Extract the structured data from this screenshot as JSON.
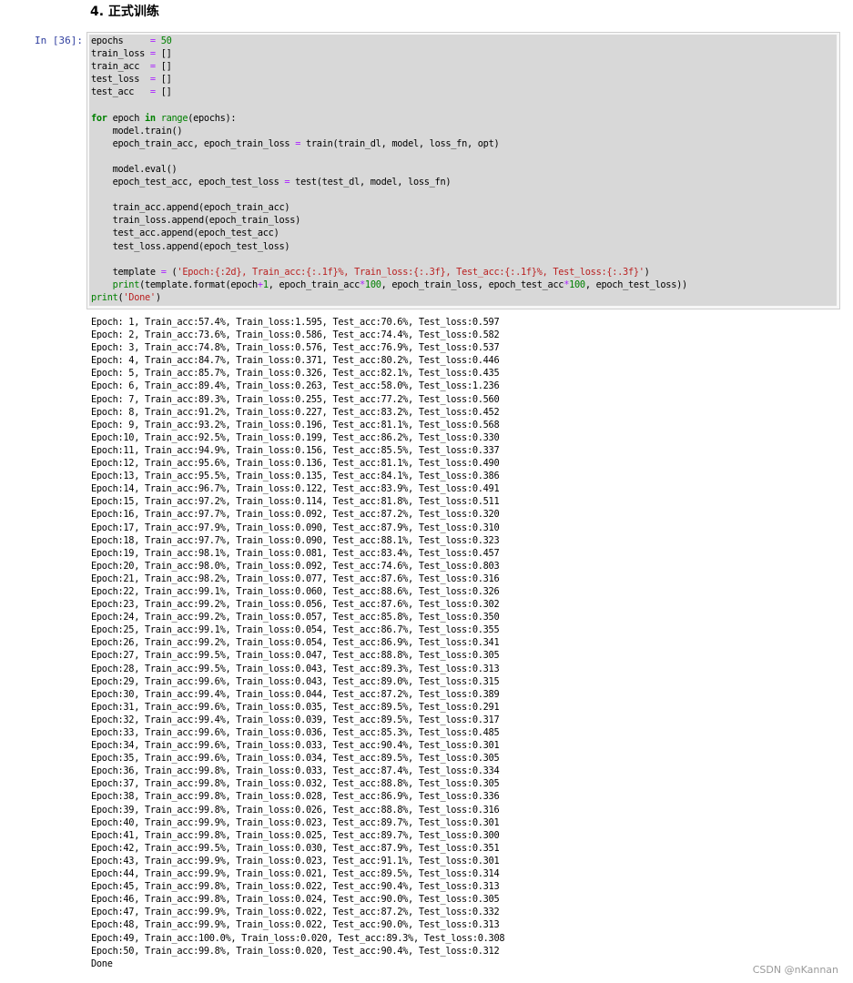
{
  "heading": "4. 正式训练",
  "cell": {
    "prompt": "In [36]:",
    "code_lines": [
      "epochs     = 50",
      "train_loss = []",
      "train_acc  = []",
      "test_loss  = []",
      "test_acc   = []",
      "",
      "for epoch in range(epochs):",
      "    model.train()",
      "    epoch_train_acc, epoch_train_loss = train(train_dl, model, loss_fn, opt)",
      "",
      "    model.eval()",
      "    epoch_test_acc, epoch_test_loss = test(test_dl, model, loss_fn)",
      "",
      "    train_acc.append(epoch_train_acc)",
      "    train_loss.append(epoch_train_loss)",
      "    test_acc.append(epoch_test_acc)",
      "    test_loss.append(epoch_test_loss)",
      "",
      "    template = ('Epoch:{:2d}, Train_acc:{:.1f}%, Train_loss:{:.3f}, Test_acc:{:.1f}%, Test_loss:{:.3f}')",
      "    print(template.format(epoch+1, epoch_train_acc*100, epoch_train_loss, epoch_test_acc*100, epoch_test_loss))",
      "print('Done')"
    ]
  },
  "output_lines": [
    "Epoch: 1, Train_acc:57.4%, Train_loss:1.595, Test_acc:70.6%, Test_loss:0.597",
    "Epoch: 2, Train_acc:73.6%, Train_loss:0.586, Test_acc:74.4%, Test_loss:0.582",
    "Epoch: 3, Train_acc:74.8%, Train_loss:0.576, Test_acc:76.9%, Test_loss:0.537",
    "Epoch: 4, Train_acc:84.7%, Train_loss:0.371, Test_acc:80.2%, Test_loss:0.446",
    "Epoch: 5, Train_acc:85.7%, Train_loss:0.326, Test_acc:82.1%, Test_loss:0.435",
    "Epoch: 6, Train_acc:89.4%, Train_loss:0.263, Test_acc:58.0%, Test_loss:1.236",
    "Epoch: 7, Train_acc:89.3%, Train_loss:0.255, Test_acc:77.2%, Test_loss:0.560",
    "Epoch: 8, Train_acc:91.2%, Train_loss:0.227, Test_acc:83.2%, Test_loss:0.452",
    "Epoch: 9, Train_acc:93.2%, Train_loss:0.196, Test_acc:81.1%, Test_loss:0.568",
    "Epoch:10, Train_acc:92.5%, Train_loss:0.199, Test_acc:86.2%, Test_loss:0.330",
    "Epoch:11, Train_acc:94.9%, Train_loss:0.156, Test_acc:85.5%, Test_loss:0.337",
    "Epoch:12, Train_acc:95.6%, Train_loss:0.136, Test_acc:81.1%, Test_loss:0.490",
    "Epoch:13, Train_acc:95.5%, Train_loss:0.135, Test_acc:84.1%, Test_loss:0.386",
    "Epoch:14, Train_acc:96.7%, Train_loss:0.122, Test_acc:83.9%, Test_loss:0.491",
    "Epoch:15, Train_acc:97.2%, Train_loss:0.114, Test_acc:81.8%, Test_loss:0.511",
    "Epoch:16, Train_acc:97.7%, Train_loss:0.092, Test_acc:87.2%, Test_loss:0.320",
    "Epoch:17, Train_acc:97.9%, Train_loss:0.090, Test_acc:87.9%, Test_loss:0.310",
    "Epoch:18, Train_acc:97.7%, Train_loss:0.090, Test_acc:88.1%, Test_loss:0.323",
    "Epoch:19, Train_acc:98.1%, Train_loss:0.081, Test_acc:83.4%, Test_loss:0.457",
    "Epoch:20, Train_acc:98.0%, Train_loss:0.092, Test_acc:74.6%, Test_loss:0.803",
    "Epoch:21, Train_acc:98.2%, Train_loss:0.077, Test_acc:87.6%, Test_loss:0.316",
    "Epoch:22, Train_acc:99.1%, Train_loss:0.060, Test_acc:88.6%, Test_loss:0.326",
    "Epoch:23, Train_acc:99.2%, Train_loss:0.056, Test_acc:87.6%, Test_loss:0.302",
    "Epoch:24, Train_acc:99.2%, Train_loss:0.057, Test_acc:85.8%, Test_loss:0.350",
    "Epoch:25, Train_acc:99.1%, Train_loss:0.054, Test_acc:86.7%, Test_loss:0.355",
    "Epoch:26, Train_acc:99.2%, Train_loss:0.054, Test_acc:86.9%, Test_loss:0.341",
    "Epoch:27, Train_acc:99.5%, Train_loss:0.047, Test_acc:88.8%, Test_loss:0.305",
    "Epoch:28, Train_acc:99.5%, Train_loss:0.043, Test_acc:89.3%, Test_loss:0.313",
    "Epoch:29, Train_acc:99.6%, Train_loss:0.043, Test_acc:89.0%, Test_loss:0.315",
    "Epoch:30, Train_acc:99.4%, Train_loss:0.044, Test_acc:87.2%, Test_loss:0.389",
    "Epoch:31, Train_acc:99.6%, Train_loss:0.035, Test_acc:89.5%, Test_loss:0.291",
    "Epoch:32, Train_acc:99.4%, Train_loss:0.039, Test_acc:89.5%, Test_loss:0.317",
    "Epoch:33, Train_acc:99.6%, Train_loss:0.036, Test_acc:85.3%, Test_loss:0.485",
    "Epoch:34, Train_acc:99.6%, Train_loss:0.033, Test_acc:90.4%, Test_loss:0.301",
    "Epoch:35, Train_acc:99.6%, Train_loss:0.034, Test_acc:89.5%, Test_loss:0.305",
    "Epoch:36, Train_acc:99.8%, Train_loss:0.033, Test_acc:87.4%, Test_loss:0.334",
    "Epoch:37, Train_acc:99.8%, Train_loss:0.032, Test_acc:88.8%, Test_loss:0.305",
    "Epoch:38, Train_acc:99.8%, Train_loss:0.028, Test_acc:86.9%, Test_loss:0.336",
    "Epoch:39, Train_acc:99.8%, Train_loss:0.026, Test_acc:88.8%, Test_loss:0.316",
    "Epoch:40, Train_acc:99.9%, Train_loss:0.023, Test_acc:89.7%, Test_loss:0.301",
    "Epoch:41, Train_acc:99.8%, Train_loss:0.025, Test_acc:89.7%, Test_loss:0.300",
    "Epoch:42, Train_acc:99.5%, Train_loss:0.030, Test_acc:87.9%, Test_loss:0.351",
    "Epoch:43, Train_acc:99.9%, Train_loss:0.023, Test_acc:91.1%, Test_loss:0.301",
    "Epoch:44, Train_acc:99.9%, Train_loss:0.021, Test_acc:89.5%, Test_loss:0.314",
    "Epoch:45, Train_acc:99.8%, Train_loss:0.022, Test_acc:90.4%, Test_loss:0.313",
    "Epoch:46, Train_acc:99.8%, Train_loss:0.024, Test_acc:90.0%, Test_loss:0.305",
    "Epoch:47, Train_acc:99.9%, Train_loss:0.022, Test_acc:87.2%, Test_loss:0.332",
    "Epoch:48, Train_acc:99.9%, Train_loss:0.022, Test_acc:90.0%, Test_loss:0.313",
    "Epoch:49, Train_acc:100.0%, Train_loss:0.020, Test_acc:89.3%, Test_loss:0.308",
    "Epoch:50, Train_acc:99.8%, Train_loss:0.020, Test_acc:90.4%, Test_loss:0.312",
    "Done"
  ],
  "watermark": "CSDN @nKannan",
  "colors": {
    "prompt": "#303F9F",
    "code_bg": "#d8d8d8",
    "keyword": "#008000",
    "string": "#BA2121",
    "operator": "#AA22FF"
  }
}
